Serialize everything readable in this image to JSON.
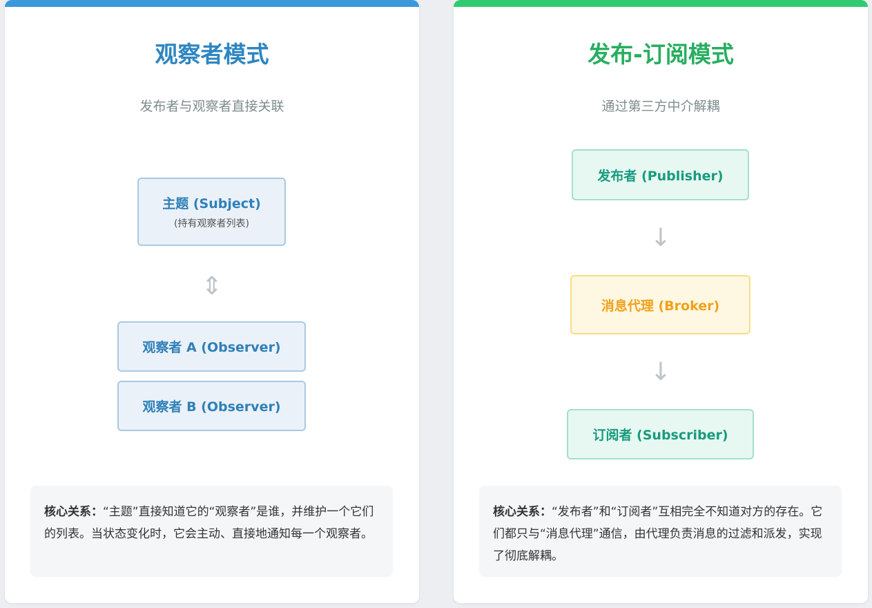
{
  "observer": {
    "title": "观察者模式",
    "subtitle": "发布者与观察者直接关联",
    "subject_label": "主题 (Subject)",
    "subject_sub": "(持有观察者列表)",
    "arrow": "⇕",
    "observer_a": "观察者 A (Observer)",
    "observer_b": "观察者 B (Observer)",
    "note_label": "核心关系：",
    "note_text": "“主题”直接知道它的“观察者”是谁，并维护一个它们的列表。当状态变化时，它会主动、直接地通知每一个观察者。",
    "accent": "#3a98db"
  },
  "pubsub": {
    "title": "发布-订阅模式",
    "subtitle": "通过第三方中介解耦",
    "publisher": "发布者 (Publisher)",
    "arrow1": "↓",
    "broker": "消息代理 (Broker)",
    "arrow2": "↓",
    "subscriber": "订阅者 (Subscriber)",
    "note_label": "核心关系：",
    "note_text": "“发布者”和“订阅者”互相完全不知道对方的存在。它们都只与“消息代理”通信，由代理负责消息的过滤和派发，实现了彻底解耦。",
    "accent": "#30cb70"
  }
}
